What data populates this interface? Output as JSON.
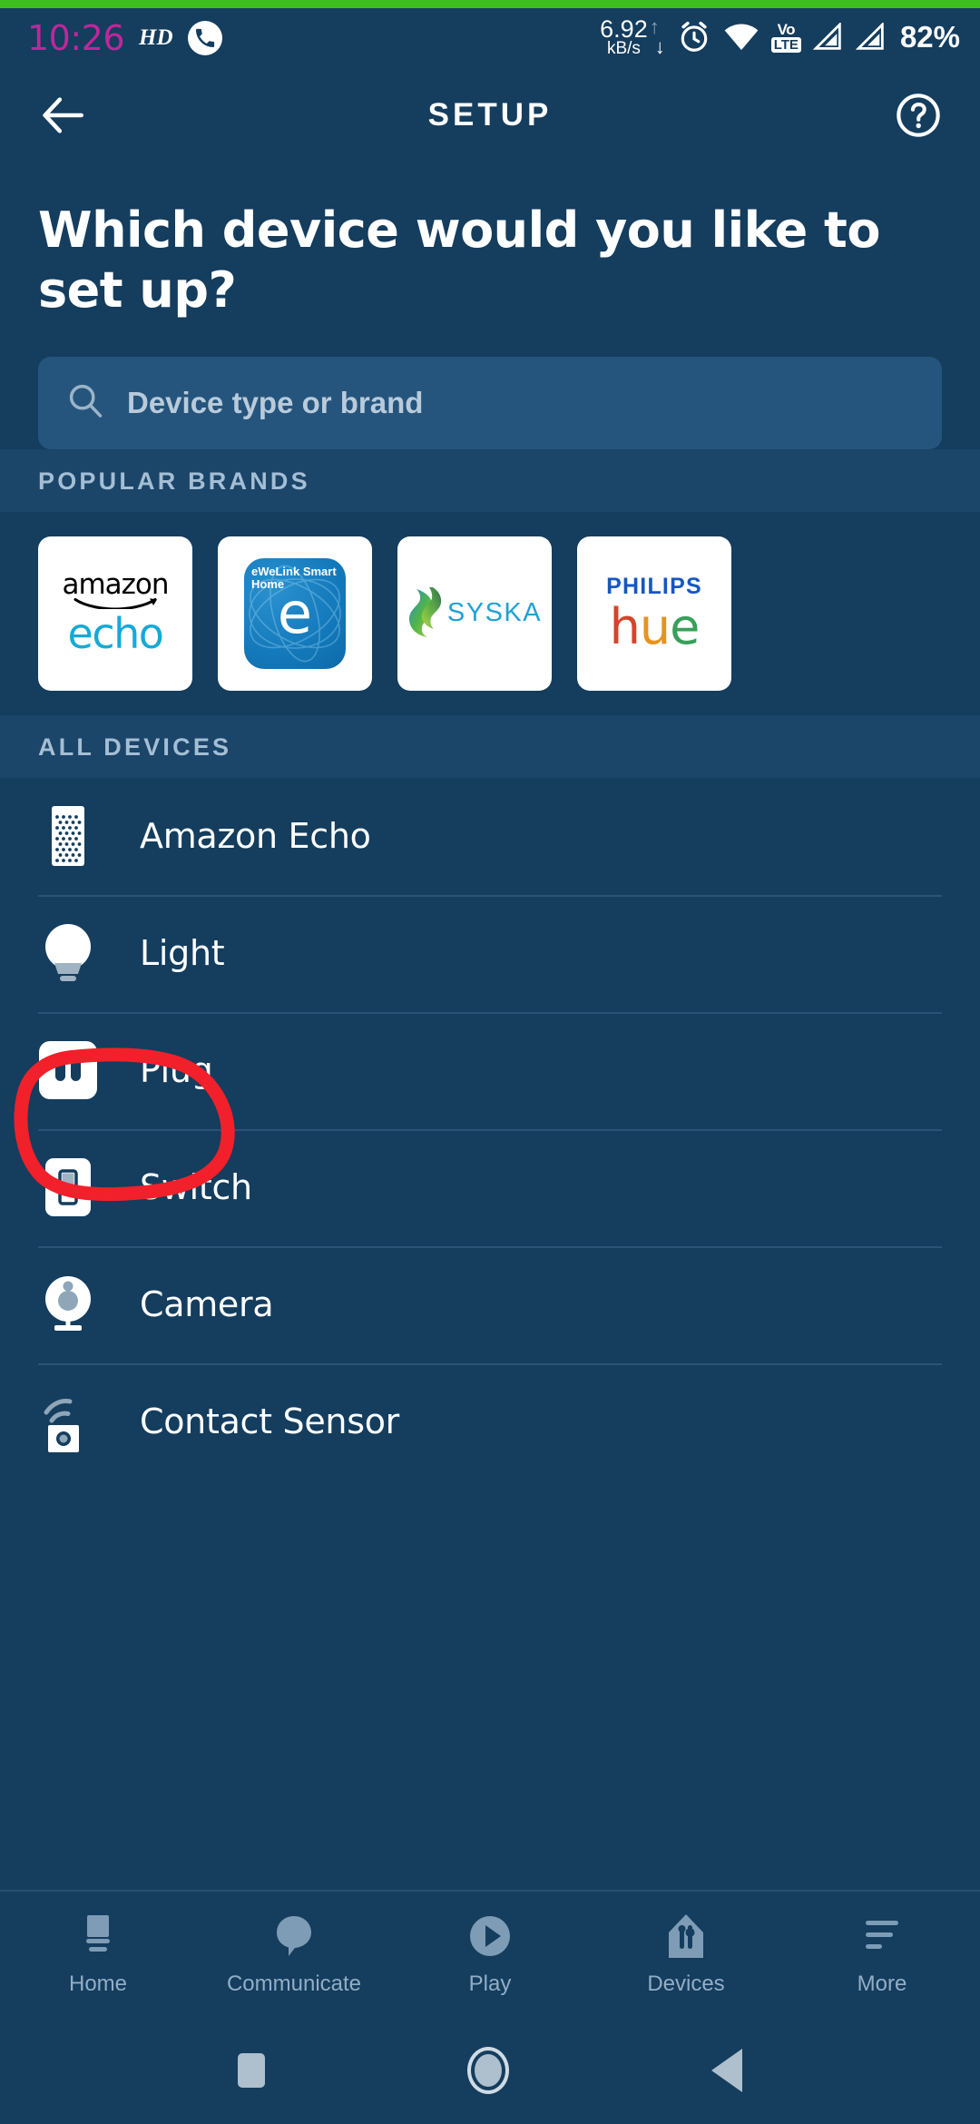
{
  "status_bar": {
    "time": "10:26",
    "hd_badge": "HD",
    "phone_icon": "phone-call-icon",
    "network_speed_value": "6.92",
    "network_speed_unit": "kB/s",
    "upload_arrow": "↑",
    "download_arrow": "↓",
    "alarm_icon": "alarm-clock-icon",
    "wifi_icon": "wifi-icon",
    "volte_top": "Vo",
    "volte_bottom": "LTE",
    "signal_icon_1": "cellular-signal-icon",
    "signal_icon_2": "cellular-signal-icon",
    "battery_percent": "82%"
  },
  "app_bar": {
    "back_icon": "back-arrow-icon",
    "title": "SETUP",
    "help_icon": "help-question-icon"
  },
  "heading": "Which device would you like to set up?",
  "search": {
    "icon": "search-icon",
    "placeholder": "Device type or brand",
    "value": ""
  },
  "popular_brands": {
    "section_label": "POPULAR BRANDS",
    "cards": [
      {
        "name": "amazon echo",
        "line1": "amazon",
        "line2": "echo"
      },
      {
        "name": "eWeLink Smart Home",
        "line1": "eWeLink Smart",
        "line2": "Home",
        "glyph": "e"
      },
      {
        "name": "SYSKA",
        "line1": "SYSKA"
      },
      {
        "name": "PHILIPS hue",
        "line1": "PHILIPS",
        "line2": "hue"
      }
    ]
  },
  "all_devices": {
    "section_label": "ALL DEVICES",
    "items": [
      {
        "label": "Amazon Echo",
        "icon": "echo-speaker-icon"
      },
      {
        "label": "Light",
        "icon": "light-bulb-icon",
        "annotated": true
      },
      {
        "label": "Plug",
        "icon": "smart-plug-icon"
      },
      {
        "label": "Switch",
        "icon": "wall-switch-icon"
      },
      {
        "label": "Camera",
        "icon": "camera-icon"
      },
      {
        "label": "Contact Sensor",
        "icon": "contact-sensor-icon"
      }
    ]
  },
  "bottom_nav": {
    "items": [
      {
        "label": "Home",
        "icon": "home-device-icon"
      },
      {
        "label": "Communicate",
        "icon": "speech-bubble-icon"
      },
      {
        "label": "Play",
        "icon": "play-circle-icon"
      },
      {
        "label": "Devices",
        "icon": "devices-icon"
      },
      {
        "label": "More",
        "icon": "more-lines-icon"
      }
    ]
  },
  "android_nav": {
    "recents_icon": "recents-square-icon",
    "home_icon": "home-circle-icon",
    "back_icon": "back-triangle-icon"
  },
  "annotation": {
    "type": "hand-drawn-circle",
    "color": "#f2202a",
    "target": "Light"
  },
  "colors": {
    "background": "#143d5e",
    "band": "#1b4569",
    "search_field": "#25557d",
    "accent_green_strip": "#3fbf1f",
    "time_magenta": "#c0269a",
    "annotation_red": "#f2202a"
  }
}
